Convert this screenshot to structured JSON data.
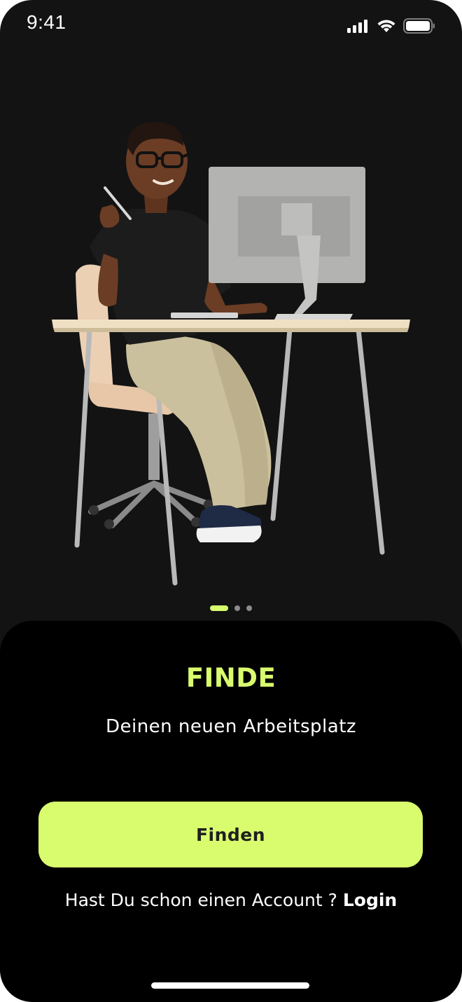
{
  "status_bar": {
    "time": "9:41"
  },
  "hero": {
    "illustration": "person-at-desk-illustration"
  },
  "pager": {
    "count": 3,
    "active_index": 0
  },
  "onboarding": {
    "title": "FINDE",
    "subtitle": "Deinen neuen Arbeitsplatz",
    "primary_button_label": "Finden",
    "login_prompt": "Hast Du schon einen Account ?",
    "login_link_label": "Login"
  },
  "colors": {
    "background": "#131313",
    "sheet": "#000000",
    "accent": "#d9fb6e",
    "button_text": "#1f1f1f",
    "text": "#ffffff"
  },
  "icons": {
    "signal": "cellular-signal-icon",
    "wifi": "wifi-icon",
    "battery": "battery-icon"
  }
}
